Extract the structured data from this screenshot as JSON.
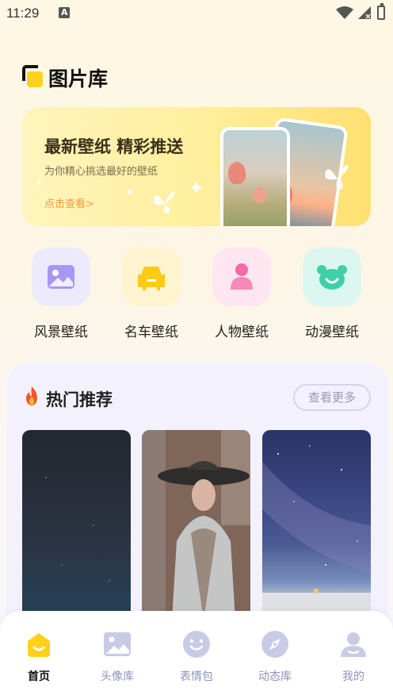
{
  "status_bar": {
    "time": "11:29",
    "notification_letter": "A"
  },
  "brand": {
    "title": "图片库"
  },
  "banner": {
    "headline": "最新壁纸 精彩推送",
    "subtitle": "为你精心挑选最好的壁纸",
    "cta": "点击查看>"
  },
  "categories": [
    {
      "label": "风景壁纸",
      "icon": "landscape-icon",
      "tile_color": "#ecebfd",
      "icon_color": "#9b8cf2"
    },
    {
      "label": "名车壁纸",
      "icon": "car-icon",
      "tile_color": "#fff4cf",
      "icon_color": "#ffc91a"
    },
    {
      "label": "人物壁纸",
      "icon": "person-icon",
      "tile_color": "#ffe6f0",
      "icon_color": "#f36aa8"
    },
    {
      "label": "动漫壁纸",
      "icon": "bear-icon",
      "tile_color": "#dcf7f0",
      "icon_color": "#3fcfa8"
    }
  ],
  "hot": {
    "title": "热门推荐",
    "more_label": "查看更多",
    "thumbnails": [
      "night-sky",
      "fashion-hat",
      "milky-way"
    ]
  },
  "tabbar": {
    "items": [
      {
        "label": "首页",
        "icon": "home-icon",
        "active": true
      },
      {
        "label": "头像库",
        "icon": "image-icon",
        "active": false
      },
      {
        "label": "表情包",
        "icon": "smiley-icon",
        "active": false
      },
      {
        "label": "动态库",
        "icon": "compass-icon",
        "active": false
      },
      {
        "label": "我的",
        "icon": "user-icon",
        "active": false
      }
    ],
    "active_color": "#ffd11a",
    "inactive_color": "#c9cbe6"
  }
}
